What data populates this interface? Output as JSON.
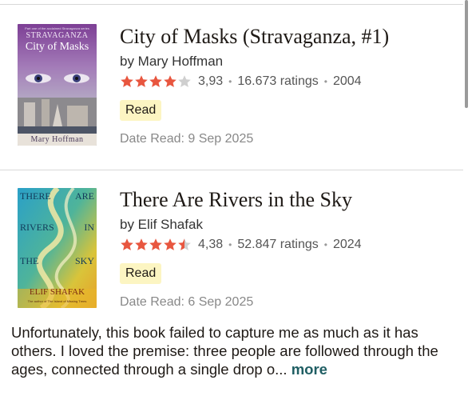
{
  "books": [
    {
      "title": "City of Masks (Stravaganza, #1)",
      "author": "by Mary Hoffman",
      "stars": 4,
      "rating": "3,93",
      "ratings_count": "16.673 ratings",
      "year": "2004",
      "shelf": "Read",
      "date_read": "Date Read: 9 Sep 2025",
      "cover": {
        "top_line": "Part one of the acclaimed Stravaganza series",
        "series": "Stravaganza",
        "title": "City of Masks",
        "author": "Mary Hoffman"
      }
    },
    {
      "title": "There Are Rivers in the Sky",
      "author": "by Elif Shafak",
      "stars": 4.5,
      "rating": "4,38",
      "ratings_count": "52.847 ratings",
      "year": "2024",
      "shelf": "Read",
      "date_read": "Date Read: 6 Sep 2025",
      "cover": {
        "w1": "THERE",
        "w2": "ARE",
        "w3": "RIVERS",
        "w4": "IN",
        "w5": "THE",
        "w6": "SKY",
        "author": "ELIF SHAFAK",
        "tagline": "The author of The Island of Missing Trees"
      }
    }
  ],
  "review": {
    "text": "Unfortunately, this book failed to capture me as much as it has others. I loved the premise: three people are followed through the ages, connected through a single drop o...",
    "more_label": "more"
  },
  "colors": {
    "star": "#e8563f",
    "star_empty": "#cfcfcf",
    "shelf_bg": "#fcf5c2",
    "more_link": "#1f5e63"
  },
  "icons": {
    "star": "star-icon"
  }
}
